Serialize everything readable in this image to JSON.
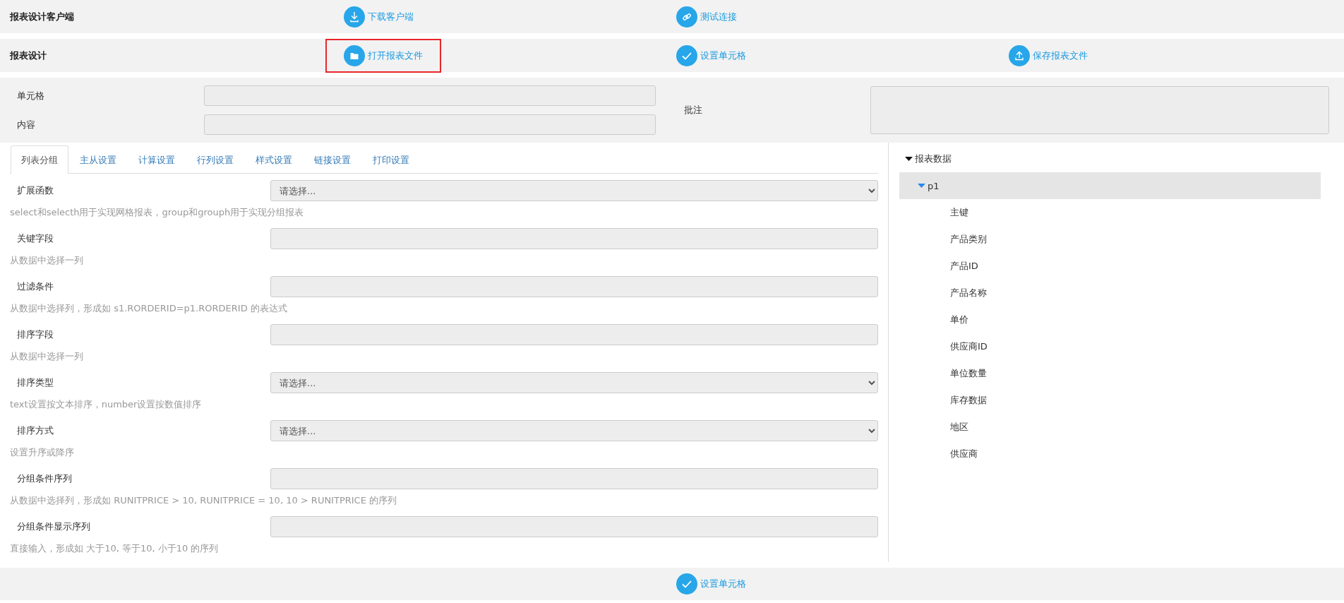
{
  "toolbars": [
    {
      "title": "报表设计客户端",
      "buttons": [
        {
          "label": "下载客户端",
          "kind": "download",
          "highlighted": false
        },
        {
          "label": "测试连接",
          "kind": "link",
          "highlighted": false
        }
      ]
    },
    {
      "title": "报表设计",
      "buttons": [
        {
          "label": "打开报表文件",
          "kind": "folder",
          "highlighted": true
        },
        {
          "label": "设置单元格",
          "kind": "check",
          "highlighted": false
        },
        {
          "label": "保存报表文件",
          "kind": "upload",
          "highlighted": false
        }
      ]
    }
  ],
  "cell_panel": {
    "fields": [
      {
        "label": "单元格"
      },
      {
        "label": "内容"
      }
    ],
    "note": {
      "label": "批注"
    }
  },
  "tabs": [
    {
      "label": "列表分组",
      "selected": true
    },
    {
      "label": "主从设置",
      "selected": false
    },
    {
      "label": "计算设置",
      "selected": false
    },
    {
      "label": "行列设置",
      "selected": false
    },
    {
      "label": "样式设置",
      "selected": false
    },
    {
      "label": "链接设置",
      "selected": false
    },
    {
      "label": "打印设置",
      "selected": false
    }
  ],
  "form": [
    {
      "label": "扩展函数",
      "kind": "select",
      "value": "请选择...",
      "hint": "select和selecth用于实现网格报表，group和grouph用于实现分组报表"
    },
    {
      "label": "关键字段",
      "kind": "input",
      "hint": "从数据中选择一列"
    },
    {
      "label": "过滤条件",
      "kind": "input",
      "hint": "从数据中选择列，形成如 s1.RORDERID=p1.RORDERID 的表达式"
    },
    {
      "label": "排序字段",
      "kind": "input",
      "hint": "从数据中选择一列"
    },
    {
      "label": "排序类型",
      "kind": "select",
      "value": "请选择...",
      "hint": "text设置按文本排序，number设置按数值排序"
    },
    {
      "label": "排序方式",
      "kind": "select",
      "value": "请选择...",
      "hint": "设置升序或降序"
    },
    {
      "label": "分组条件序列",
      "kind": "input",
      "hint": "从数据中选择列，形成如 RUNITPRICE > 10, RUNITPRICE = 10, 10 > RUNITPRICE 的序列"
    },
    {
      "label": "分组条件显示序列",
      "kind": "input",
      "hint": "直接输入，形成如 大于10, 等于10, 小于10 的序列"
    }
  ],
  "tree": [
    {
      "label": "报表数据",
      "expanded": true,
      "selected": false,
      "children": [
        {
          "label": "p1",
          "expanded": true,
          "selected": true,
          "children": [
            {
              "label": "主键",
              "selected": false
            },
            {
              "label": "产品类别",
              "selected": false
            },
            {
              "label": "产品ID",
              "selected": false
            },
            {
              "label": "产品名称",
              "selected": false
            },
            {
              "label": "单价",
              "selected": false
            },
            {
              "label": "供应商ID",
              "selected": false
            },
            {
              "label": "单位数量",
              "selected": false
            },
            {
              "label": "库存数据",
              "selected": false
            },
            {
              "label": "地区",
              "selected": false
            },
            {
              "label": "供应商",
              "selected": false
            }
          ]
        }
      ]
    }
  ],
  "footer": {
    "button": {
      "label": "设置单元格",
      "kind": "check",
      "highlighted": false
    }
  }
}
